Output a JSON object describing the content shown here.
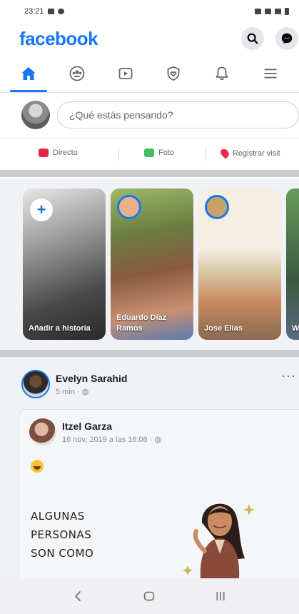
{
  "status_bar": {
    "time": "23:21"
  },
  "header": {
    "logo": "facebook",
    "search_icon": "search-icon",
    "messenger_icon": "messenger-icon"
  },
  "tabs": [
    {
      "name": "home",
      "icon": "home-icon",
      "active": true
    },
    {
      "name": "groups",
      "icon": "groups-icon",
      "active": false
    },
    {
      "name": "watch",
      "icon": "video-icon",
      "active": false
    },
    {
      "name": "dating",
      "icon": "shield-heart-icon",
      "active": false
    },
    {
      "name": "notifications",
      "icon": "bell-icon",
      "active": false
    },
    {
      "name": "menu",
      "icon": "hamburger-menu-icon",
      "active": false
    }
  ],
  "composer": {
    "placeholder": "¿Qué estás pensando?"
  },
  "actions": [
    {
      "label": "Directo",
      "color": "#e42645"
    },
    {
      "label": "Foto",
      "color": "#45bd62"
    },
    {
      "label": "Registrar visit",
      "color": "#f02849"
    }
  ],
  "stories": [
    {
      "label": "Añadir a historia"
    },
    {
      "label": "Eduardo Díaz Ramos"
    },
    {
      "label": "Jose Elias"
    },
    {
      "label": "W"
    }
  ],
  "post": {
    "author": "Evelyn Sarahid",
    "meta": "5 min · ",
    "shared": {
      "author": "Itzel Garza",
      "meta": "16 nov, 2019 a las 16:06 · ",
      "meme_lines": [
        "ALGUNAS",
        "PERSONAS",
        "SON COMO"
      ]
    }
  },
  "colors": {
    "brand": "#1877f2",
    "background": "#f0f2f5"
  }
}
